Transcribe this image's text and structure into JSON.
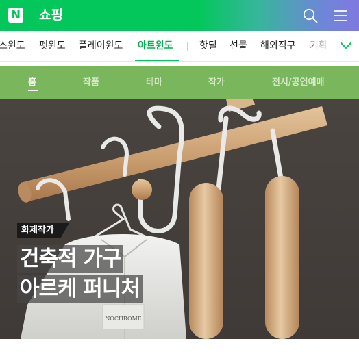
{
  "header": {
    "logo_text": "N",
    "title": "쇼핑",
    "search_icon": "search-icon",
    "menu_icon": "hamburger-menu-icon",
    "gradient_colors": [
      "#03c75a",
      "#7f79e0"
    ]
  },
  "category_nav": {
    "items": [
      {
        "label": "스윈도"
      },
      {
        "label": "펫윈도"
      },
      {
        "label": "플레이윈도"
      },
      {
        "label": "아트윈도",
        "active": true
      },
      {
        "label": "핫딜"
      },
      {
        "label": "선물"
      },
      {
        "label": "해외직구"
      },
      {
        "label": "기획"
      }
    ],
    "more_icon": "chevron-down-icon",
    "accent_color": "#03c75a"
  },
  "sub_tabs": {
    "background": "#79b65c",
    "items": [
      {
        "label": "홈",
        "active": true
      },
      {
        "label": "작품"
      },
      {
        "label": "테마"
      },
      {
        "label": "작가"
      },
      {
        "label": "전시/공연예매"
      }
    ]
  },
  "hero": {
    "badge": "화제작가",
    "headline_line1": "건축적 가구",
    "headline_line2": "아르케 퍼니처",
    "shirt_tag": "NOCHROME"
  }
}
